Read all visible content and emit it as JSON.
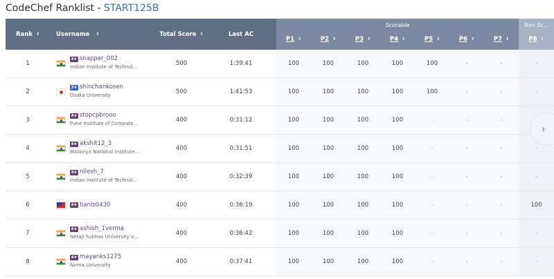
{
  "page": {
    "title_prefix": "CodeChef Ranklist - ",
    "contest": "START125B"
  },
  "table": {
    "group_scorable": "Scorable",
    "group_nonscorable": "Non Sc...",
    "sort_icon": "⬍",
    "columns": {
      "rank": "Rank",
      "username": "Username",
      "total_score": "Total Score",
      "last_ac": "Last AC"
    },
    "problems": [
      "P1",
      "P2",
      "P3",
      "P4",
      "P5",
      "P6",
      "P7",
      "P8"
    ],
    "rows": [
      {
        "rank": "1",
        "flag": "india",
        "stars": "4★",
        "username": "snapper_002",
        "institution": "Indian Institute of Technol...",
        "score": "500",
        "last_ac": "1:39:41",
        "p": [
          "100",
          "100",
          "100",
          "100",
          "100",
          "-",
          "-",
          "-"
        ]
      },
      {
        "rank": "2",
        "flag": "japan",
        "stars": "3★",
        "username": "shinchankosen",
        "institution": "Osaka University",
        "score": "500",
        "last_ac": "1:41:53",
        "p": [
          "100",
          "100",
          "100",
          "100",
          "100",
          "-",
          "-",
          "-"
        ]
      },
      {
        "rank": "3",
        "flag": "india",
        "stars": "4★",
        "username": "stopcpbrooo",
        "institution": "Pune Institute of Compute...",
        "score": "400",
        "last_ac": "0:31:12",
        "p": [
          "100",
          "100",
          "100",
          "100",
          "-",
          "-",
          "-",
          "-"
        ]
      },
      {
        "rank": "4",
        "flag": "india",
        "stars": "4★",
        "username": "akshit12_3",
        "institution": "Malaviya National Institute...",
        "score": "400",
        "last_ac": "0:31:51",
        "p": [
          "100",
          "100",
          "100",
          "100",
          "-",
          "-",
          "-",
          "-"
        ]
      },
      {
        "rank": "5",
        "flag": "india",
        "stars": "4★",
        "username": "nilesh_7",
        "institution": "Indian Institute of Technol...",
        "score": "400",
        "last_ac": "0:32:39",
        "p": [
          "100",
          "100",
          "100",
          "100",
          "-",
          "-",
          "-",
          "-"
        ]
      },
      {
        "rank": "6",
        "flag": "taiwan",
        "stars": "4★",
        "username": "banis0430",
        "institution": "",
        "score": "400",
        "last_ac": "0:36:19",
        "p": [
          "100",
          "100",
          "100",
          "100",
          "-",
          "-",
          "-",
          "100"
        ]
      },
      {
        "rank": "7",
        "flag": "india",
        "stars": "4★",
        "username": "ashish_1verma",
        "institution": "Netaji Subhas University o...",
        "score": "400",
        "last_ac": "0:36:42",
        "p": [
          "100",
          "100",
          "100",
          "100",
          "-",
          "-",
          "-",
          "-"
        ]
      },
      {
        "rank": "8",
        "flag": "india",
        "stars": "4★",
        "username": "mayanks1275",
        "institution": "Nirma University",
        "score": "400",
        "last_ac": "0:37:41",
        "p": [
          "100",
          "100",
          "100",
          "100",
          "-",
          "-",
          "-",
          "-"
        ]
      }
    ]
  },
  "controls": {
    "next_icon": "›"
  },
  "colors": {
    "header_bg": "#5f6f84",
    "scorable_header_bg": "#7b8aa2",
    "nonscorable_header_bg": "#a5b1c5",
    "contest_link": "#3b6cb2",
    "username_link": "#5a4b8e"
  }
}
